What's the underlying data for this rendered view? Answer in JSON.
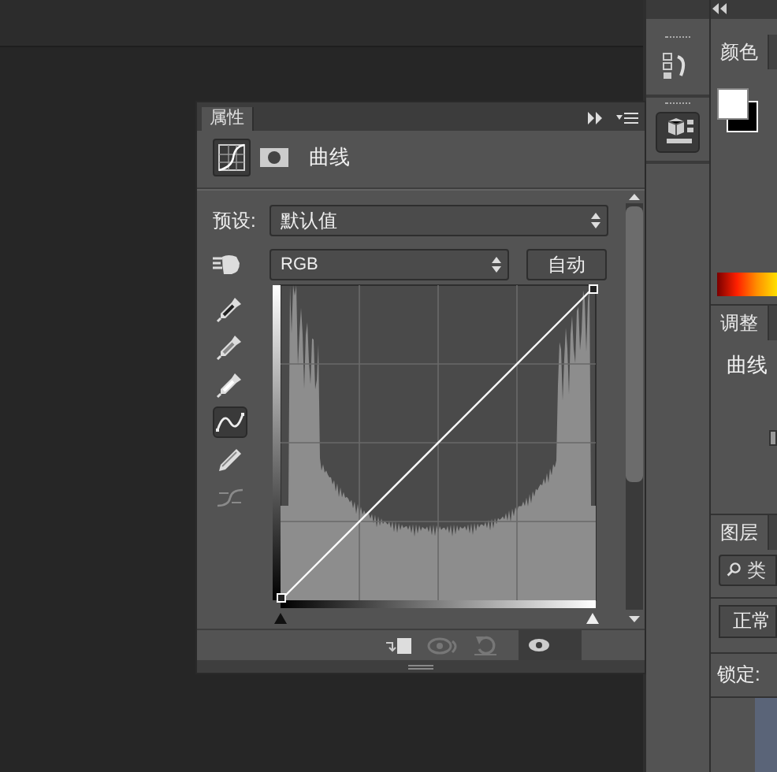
{
  "panel": {
    "tab": "属性",
    "title": "曲线",
    "modes": [
      {
        "kind": "adjustment",
        "selected": true
      },
      {
        "kind": "mask",
        "selected": false
      }
    ],
    "preset_label": "预设:",
    "preset": "默认值",
    "channel": "RGB",
    "auto_button": "自动",
    "tools": [
      {
        "kind": "sample-black",
        "selected": false,
        "disabled": false
      },
      {
        "kind": "sample-gray",
        "selected": false,
        "disabled": false
      },
      {
        "kind": "sample-white",
        "selected": false,
        "disabled": false
      },
      {
        "kind": "point",
        "selected": true,
        "disabled": false
      },
      {
        "kind": "pencil",
        "selected": false,
        "disabled": false
      },
      {
        "kind": "smooth",
        "selected": false,
        "disabled": true
      }
    ]
  },
  "dock": [
    {
      "kind": "history",
      "selected": false
    },
    {
      "kind": "cube",
      "selected": true
    }
  ],
  "input_sliders": [
    {
      "kind": "shadow",
      "level": 0
    },
    {
      "kind": "highlight",
      "level": 1
    }
  ],
  "right_panels": {
    "color_tab": "颜色",
    "adjust_tab": "调整",
    "adjust_item": "曲线",
    "layers_tab": "图层",
    "filter_field": "类",
    "blend_mode": "正常",
    "lock_label": "锁定:"
  }
}
